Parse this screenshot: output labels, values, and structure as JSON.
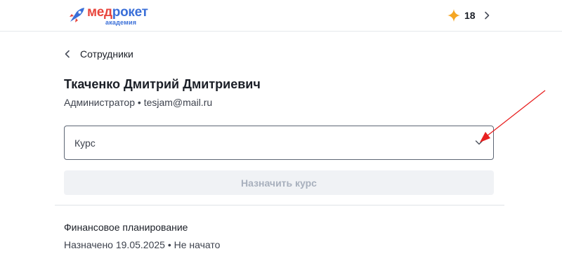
{
  "header": {
    "logo": {
      "main_part1": "мед",
      "main_part2": "рокет",
      "sub": "академия"
    },
    "points": {
      "value": "18",
      "icon": "star-icon"
    }
  },
  "nav": {
    "back_label": "Сотрудники",
    "back_icon": "chevron-left-icon"
  },
  "employee": {
    "name": "Ткаченко Дмитрий Дмитриевич",
    "meta": "Администратор • tesjam@mail.ru"
  },
  "assign": {
    "select_label": "Курс",
    "button_label": "Назначить курс"
  },
  "courses": [
    {
      "title": "Финансовое планирование",
      "status": "Назначено 19.05.2025 • Не начато"
    }
  ],
  "colors": {
    "brand_red": "#e8453c",
    "brand_blue": "#3a6fd8",
    "star": "#f5a623",
    "annotation": "#e82020",
    "disabled_button_bg": "#f0f2f5",
    "disabled_button_text": "#a8b0bd"
  }
}
